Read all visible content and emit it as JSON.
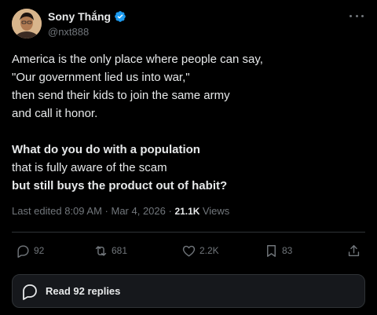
{
  "author": {
    "display_name": "Sony Thắng",
    "handle": "@nxt888",
    "verified": true,
    "verified_color": "#1d9bf0"
  },
  "tweet": {
    "lines": [
      {
        "text": "America is the only place where people can say,",
        "bold": false
      },
      {
        "text": "\"Our government lied us into war,\"",
        "bold": false
      },
      {
        "text": "then send their kids to join the same army",
        "bold": false
      },
      {
        "text": "and call it honor.",
        "bold": false
      },
      {
        "text": "What do you do with a population",
        "bold": true
      },
      {
        "text": "that is fully aware of the scam",
        "bold": false
      },
      {
        "text": "but still buys the product out of habit?",
        "bold": true
      }
    ]
  },
  "meta": {
    "edited_label": "Last edited 8:09 AM",
    "separator": "·",
    "date": "Mar 4, 2026",
    "views_count": "21.1K",
    "views_label": "Views"
  },
  "actions": {
    "replies": "92",
    "retweets": "681",
    "likes": "2.2K",
    "bookmarks": "83"
  },
  "read_replies": {
    "label": "Read 92 replies"
  },
  "icons": {
    "more": "more-horizontal-icon",
    "verified": "verified-badge-icon",
    "reply": "reply-icon",
    "retweet": "retweet-icon",
    "like": "heart-icon",
    "bookmark": "bookmark-icon",
    "share": "share-icon",
    "replies": "speech-bubble-icon"
  },
  "colors": {
    "background": "#000000",
    "text": "#e7e9ea",
    "muted": "#71767b",
    "divider": "#2f3336"
  }
}
